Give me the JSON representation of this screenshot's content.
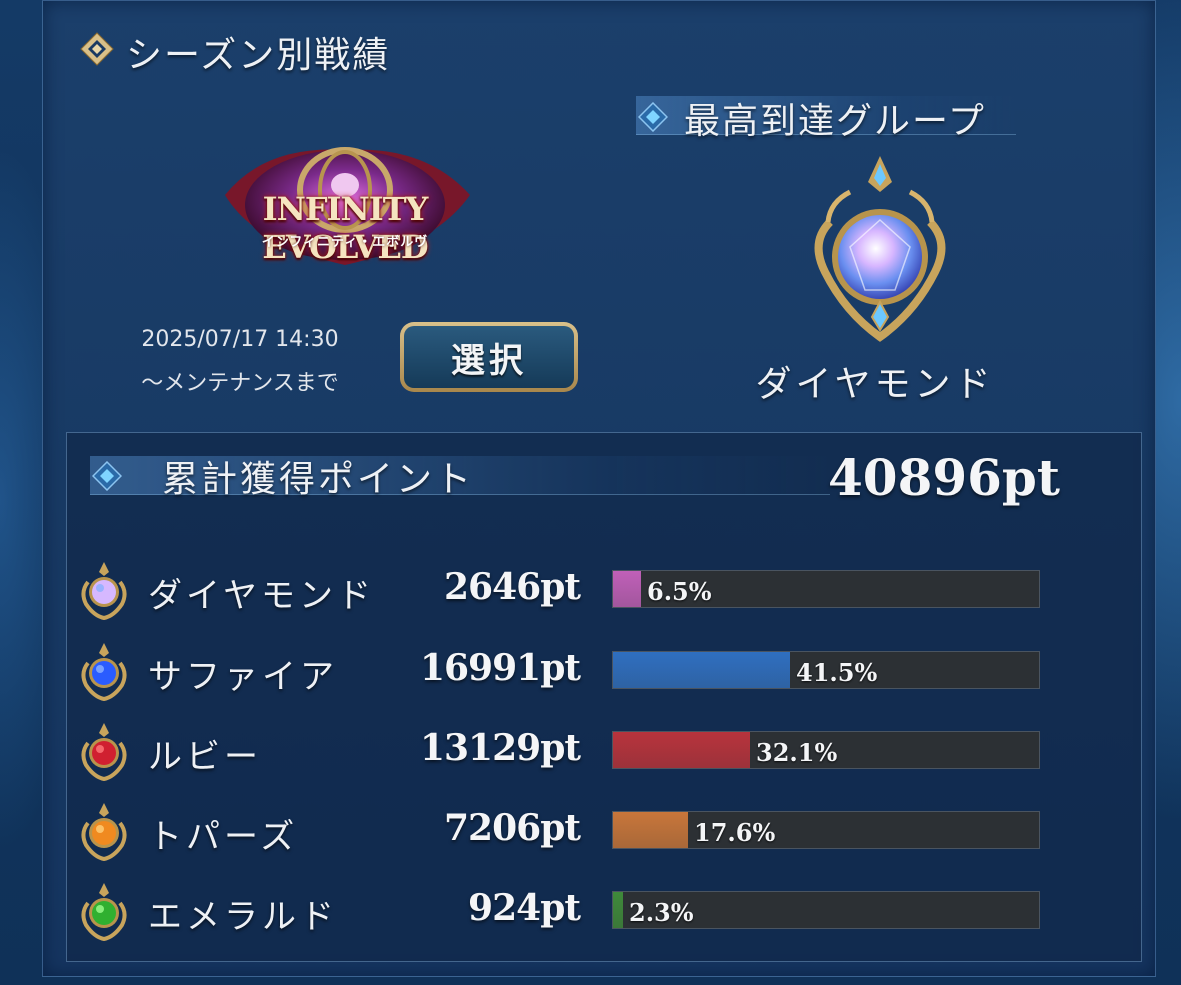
{
  "season": {
    "title": "シーズン別戦績",
    "logo_title": "INFINITY EVOLVED",
    "logo_subtitle": "インフィニティ・エボルヴ",
    "date_line1": "2025/07/17 14:30",
    "date_line2": "〜メンテナンスまで",
    "select_label": "選択"
  },
  "best_group": {
    "title": "最高到達グループ",
    "rank_name": "ダイヤモンド"
  },
  "points": {
    "title": "累計獲得ポイント",
    "total": "40896pt",
    "rows": [
      {
        "name": "ダイヤモンド",
        "points": "2646pt",
        "percent_label": "6.5%",
        "fraction": 0.065,
        "color": "#c060b8"
      },
      {
        "name": "サファイア",
        "points": "16991pt",
        "percent_label": "41.5%",
        "fraction": 0.415,
        "color": "#2f6fc0"
      },
      {
        "name": "ルビー",
        "points": "13129pt",
        "percent_label": "32.1%",
        "fraction": 0.321,
        "color": "#b8333c"
      },
      {
        "name": "トパーズ",
        "points": "7206pt",
        "percent_label": "17.6%",
        "fraction": 0.176,
        "color": "#c8763a"
      },
      {
        "name": "エメラルド",
        "points": "924pt",
        "percent_label": "2.3%",
        "fraction": 0.023,
        "color": "#3f8a3a"
      }
    ]
  },
  "icons": {
    "bullet": "diamond-bullet-icon",
    "gems": [
      "diamond-gem-icon",
      "sapphire-gem-icon",
      "ruby-gem-icon",
      "topaz-gem-icon",
      "emerald-gem-icon"
    ]
  }
}
